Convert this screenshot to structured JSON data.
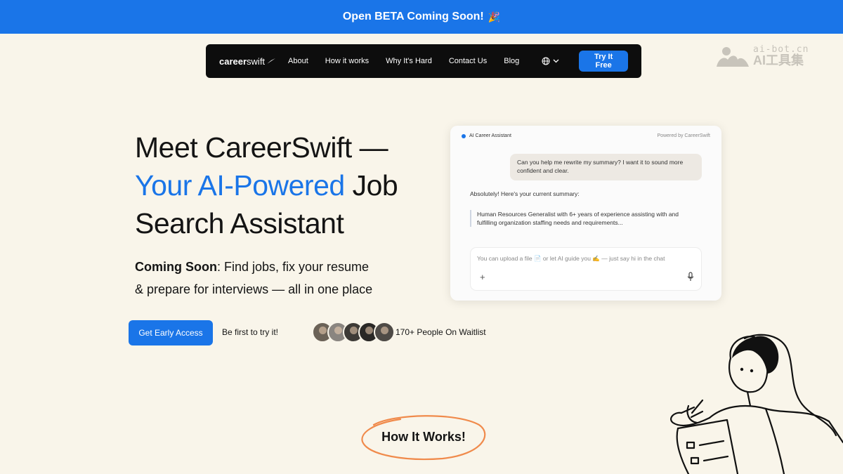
{
  "banner": {
    "text": "Open BETA Coming Soon!",
    "emoji": "🎉"
  },
  "navbar": {
    "logo_bold": "career",
    "logo_regular": "swift",
    "items": [
      {
        "label": "About"
      },
      {
        "label": "How it works"
      },
      {
        "label": "Why It's Hard"
      },
      {
        "label": "Contact Us"
      },
      {
        "label": "Blog"
      }
    ],
    "language_icon": "globe-icon",
    "cta": "Try It Free"
  },
  "watermark": {
    "top": "ai-bot.cn",
    "bottom": "AI工具集"
  },
  "hero": {
    "title_line1": "Meet CareerSwift —",
    "title_accent": "Your AI-Powered",
    "title_after_accent": " Job",
    "title_line3": "Search Assistant",
    "subtitle_bold": "Coming Soon",
    "subtitle_rest": ": Find jobs, fix your resume",
    "subtitle_line2": "& prepare for interviews — all in one place",
    "cta_button": "Get Early Access",
    "cta_note": "Be first to try it!",
    "waitlist": "170+ People On Waitlist",
    "avatar_colors": [
      "#6b6257",
      "#8a8580",
      "#3d3a36",
      "#2a2826",
      "#4e4a46"
    ]
  },
  "chat": {
    "title": "AI Career Assistant",
    "powered_by": "Powered by CareerSwift",
    "user_message": "Can you help me rewrite my summary? I want it to sound more confident and clear.",
    "bot_message": "Absolutely! Here's your current summary:",
    "quote": "Human Resources Generalist with 6+ years of experience assisting with and fulfilling organization staffing needs and requirements...",
    "input_placeholder": "You can upload a file 📄 or let AI guide you ✍️ — just say hi in the chat",
    "attach_label": "+"
  },
  "how_it_works": {
    "label": "How It Works!",
    "circle_color": "#f08a4b"
  },
  "colors": {
    "accent": "#1a75e8",
    "background": "#f9f5ea",
    "navbar": "#0d0d0d"
  }
}
